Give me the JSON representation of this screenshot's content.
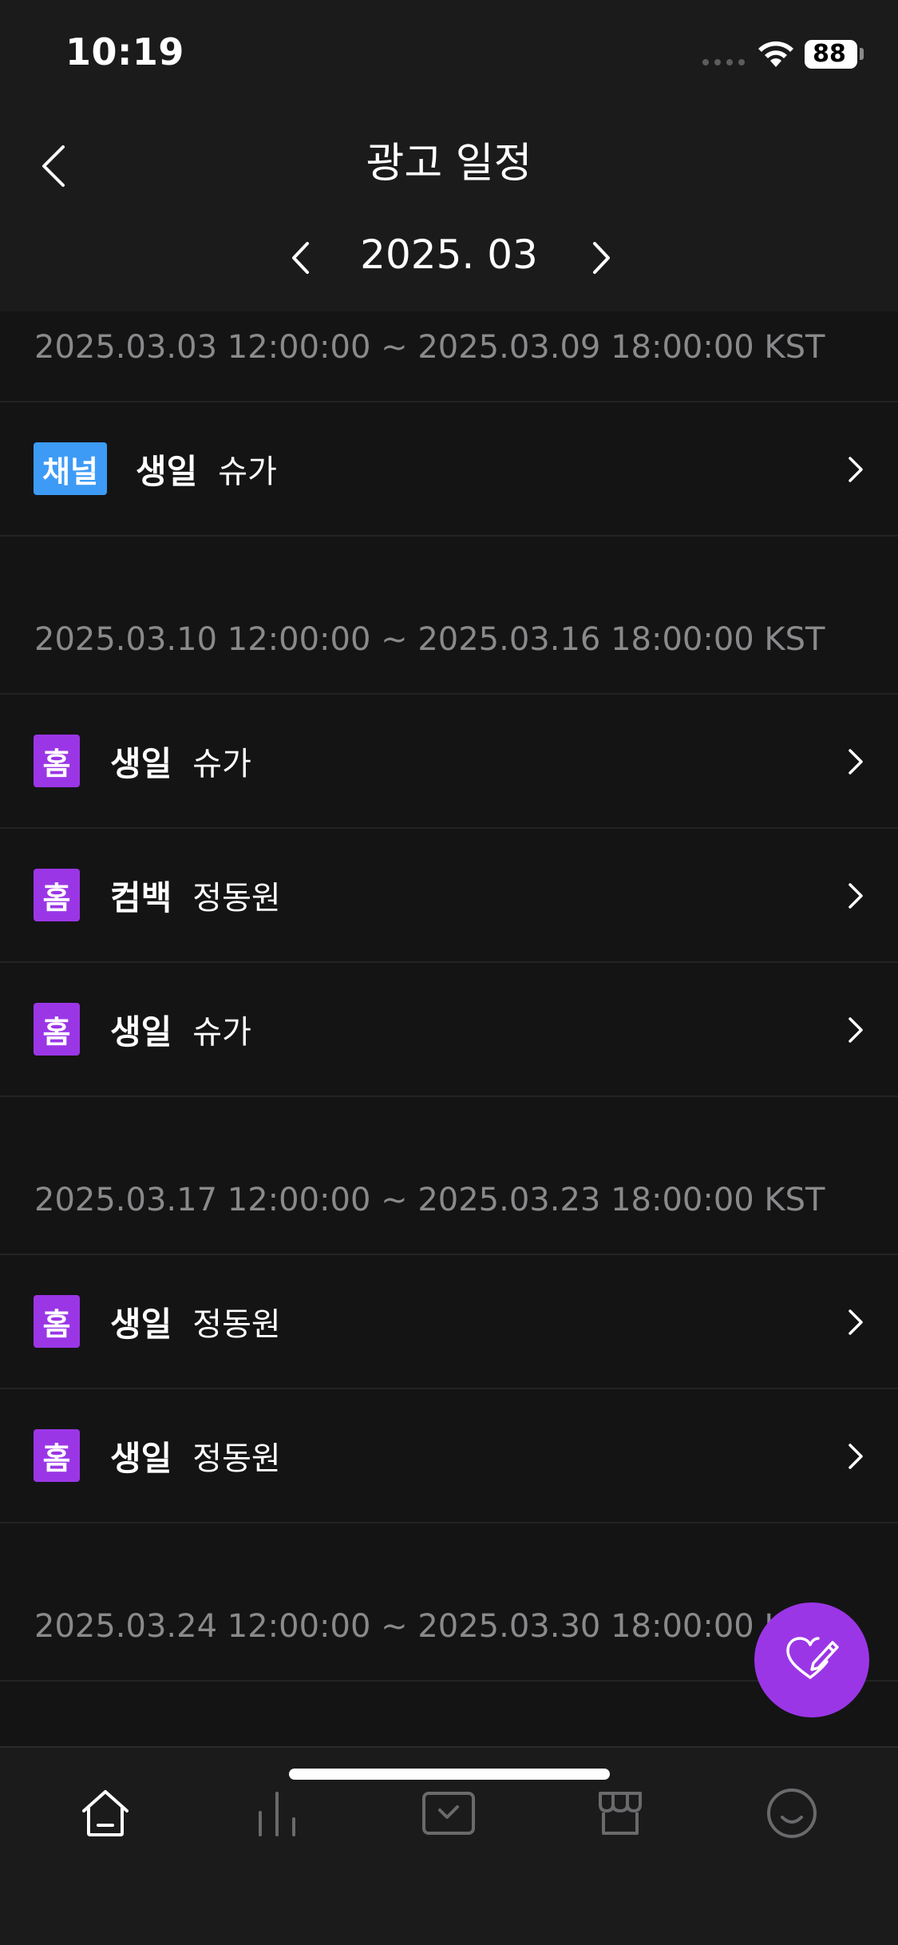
{
  "status_bar": {
    "time": "10:19",
    "battery": "88",
    "battery_percent": 88
  },
  "header": {
    "title": "광고 일정",
    "month": "2025. 03"
  },
  "colors": {
    "background": "#141415",
    "header_background": "#1b1b1c",
    "channel_badge": "#3d9bf6",
    "home_badge": "#9b36e6",
    "fab": "#9b36e6",
    "secondary_text": "#8a8a8c"
  },
  "schedule": {
    "groups": [
      {
        "range": "2025.03.03 12:00:00 ~ 2025.03.09 18:00:00 KST",
        "items": [
          {
            "badge": "채널",
            "type": "생일",
            "name": "슈가"
          }
        ]
      },
      {
        "range": "2025.03.10 12:00:00 ~ 2025.03.16 18:00:00 KST",
        "items": [
          {
            "badge": "홈",
            "type": "생일",
            "name": "슈가"
          },
          {
            "badge": "홈",
            "type": "컴백",
            "name": "정동원"
          },
          {
            "badge": "홈",
            "type": "생일",
            "name": "슈가"
          }
        ]
      },
      {
        "range": "2025.03.17 12:00:00 ~ 2025.03.23 18:00:00 KST",
        "items": [
          {
            "badge": "홈",
            "type": "생일",
            "name": "정동원"
          },
          {
            "badge": "홈",
            "type": "생일",
            "name": "정동원"
          }
        ]
      },
      {
        "range": "2025.03.24 12:00:00 ~ 2025.03.30 18:00:00 KST",
        "items": []
      }
    ]
  },
  "icons": {
    "back": "chevron-left-icon",
    "prev_month": "chevron-left-icon",
    "next_month": "chevron-right-icon",
    "row": "chevron-right-icon",
    "fab": "heart-pencil-icon",
    "tabs": [
      "home-icon",
      "chart-icon",
      "check-box-icon",
      "store-icon",
      "smile-icon"
    ]
  }
}
